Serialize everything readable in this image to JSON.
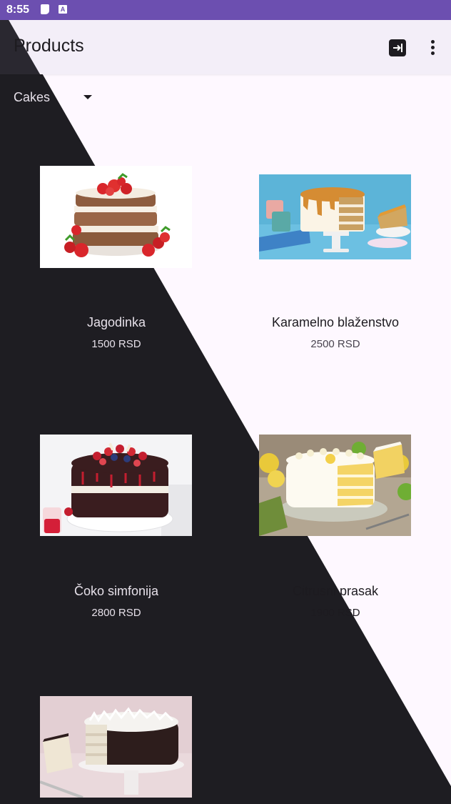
{
  "status_bar": {
    "time": "8:55",
    "icons": [
      "storage-icon",
      "a-icon"
    ],
    "color": "#6c4fb0"
  },
  "app_bar": {
    "title": "Products",
    "actions": [
      "logout-icon",
      "more-vert-icon"
    ]
  },
  "filter": {
    "selected_category": "Cakes"
  },
  "products": [
    {
      "name": "Jagodinka",
      "price": "1500 RSD",
      "image": "strawberry-naked-cake"
    },
    {
      "name": "Karamelno blaženstvo",
      "price": "2500 RSD",
      "image": "caramel-drip-cake"
    },
    {
      "name": "Čoko simfonija",
      "price": "2800 RSD",
      "image": "chocolate-berry-cake"
    },
    {
      "name": "Citrusni prasak",
      "price": "1900 RSD",
      "image": "lemon-layer-cake"
    },
    {
      "name": "",
      "price": "",
      "image": "coconut-chocolate-cake"
    }
  ],
  "colors": {
    "dark_background": "#1e1d22",
    "light_background": "#fef8ff",
    "app_bar": "#f3eef8"
  }
}
